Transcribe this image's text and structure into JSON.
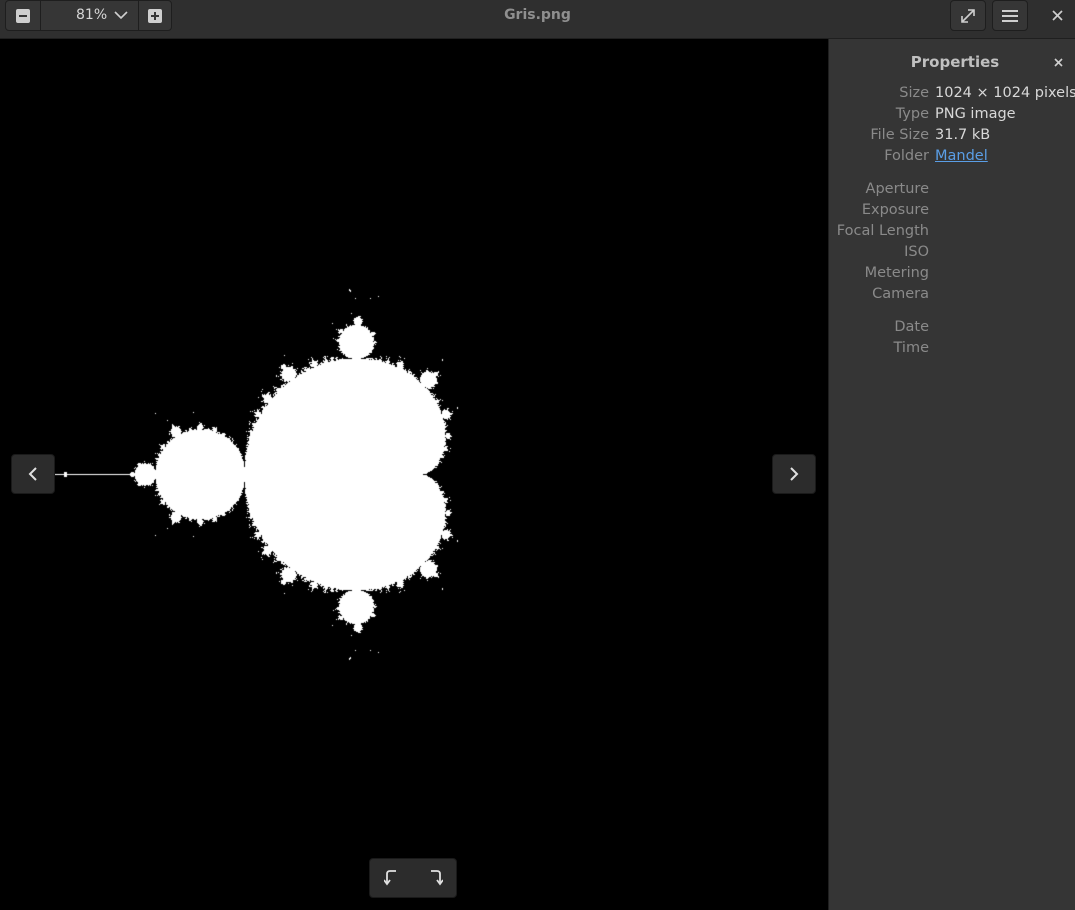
{
  "window": {
    "title": "Gris.png"
  },
  "toolbar": {
    "zoom_level": "81%",
    "zoom_out_icon": "zoom-out-icon",
    "zoom_in_icon": "zoom-in-icon",
    "zoom_menu_icon": "chevron-down-icon",
    "fullscreen_icon": "fullscreen-icon",
    "menu_icon": "hamburger-menu-icon",
    "close_icon": "close-icon"
  },
  "viewer": {
    "prev_icon": "chevron-left-icon",
    "next_icon": "chevron-right-icon",
    "rotate_left_icon": "rotate-left-icon",
    "rotate_right_icon": "rotate-right-icon",
    "background_color": "#000000",
    "image_color": "#ffffff"
  },
  "sidebar": {
    "title": "Properties",
    "close_icon": "close-icon",
    "general": [
      {
        "label": "Size",
        "value": "1024 × 1024 pixels"
      },
      {
        "label": "Type",
        "value": "PNG image"
      },
      {
        "label": "File Size",
        "value": "31.7 kB"
      },
      {
        "label": "Folder",
        "value": "Mandel"
      }
    ],
    "exif": [
      {
        "label": "Aperture",
        "value": ""
      },
      {
        "label": "Exposure",
        "value": ""
      },
      {
        "label": "Focal Length",
        "value": ""
      },
      {
        "label": "ISO",
        "value": ""
      },
      {
        "label": "Metering",
        "value": ""
      },
      {
        "label": "Camera",
        "value": ""
      }
    ],
    "datetime": [
      {
        "label": "Date",
        "value": ""
      },
      {
        "label": "Time",
        "value": ""
      }
    ]
  }
}
